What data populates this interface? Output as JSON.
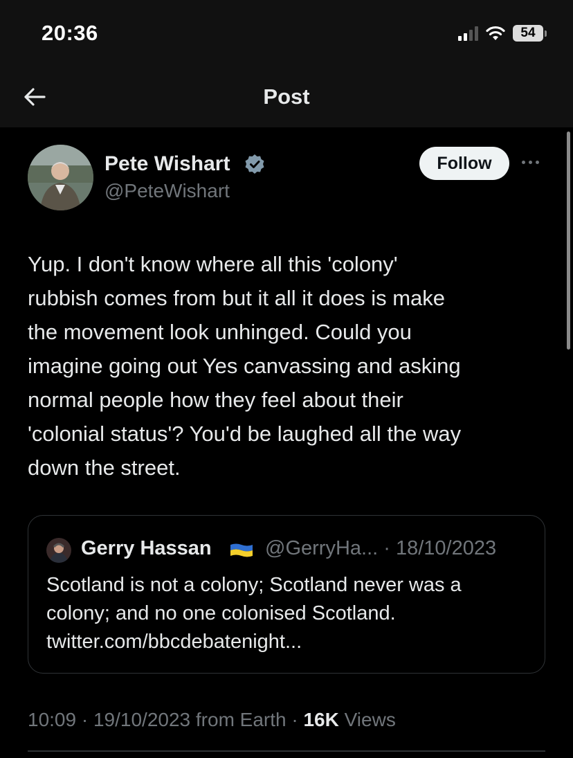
{
  "status_bar": {
    "time": "20:36",
    "battery": "54"
  },
  "nav": {
    "title": "Post"
  },
  "author": {
    "name": "Pete Wishart",
    "handle": "@PeteWishart",
    "follow_label": "Follow"
  },
  "post": {
    "text": "Yup. I don't know where all this 'colony'\nrubbish comes from but it all it does is make\nthe movement look unhinged. Could you\nimagine going out Yes canvassing and asking\nnormal people how they feel about their\n'colonial status'? You'd be laughed all the way\ndown the street.",
    "time": "10:09",
    "date": "19/10/2023",
    "source": "from Earth",
    "views_count": "16K",
    "views_label": "Views"
  },
  "quote": {
    "name": "Gerry Hassan",
    "handle": "@GerryHa...",
    "date": "18/10/2023",
    "text": "Scotland is not a colony; Scotland never was a\ncolony; and no one colonised Scotland.\ntwitter.com/bbcdebatenight..."
  },
  "icons": {
    "back": "arrow-left-icon",
    "verified": "verified-badge-icon",
    "more": "more-horizontal-icon",
    "flag": "ukraine-flag-icon"
  },
  "colors": {
    "background": "#000000",
    "header": "#111111",
    "text": "#e7e9ea",
    "muted": "#71767b",
    "border": "#2f3336",
    "follow_bg": "#eff3f4",
    "verified": "#829aab"
  }
}
